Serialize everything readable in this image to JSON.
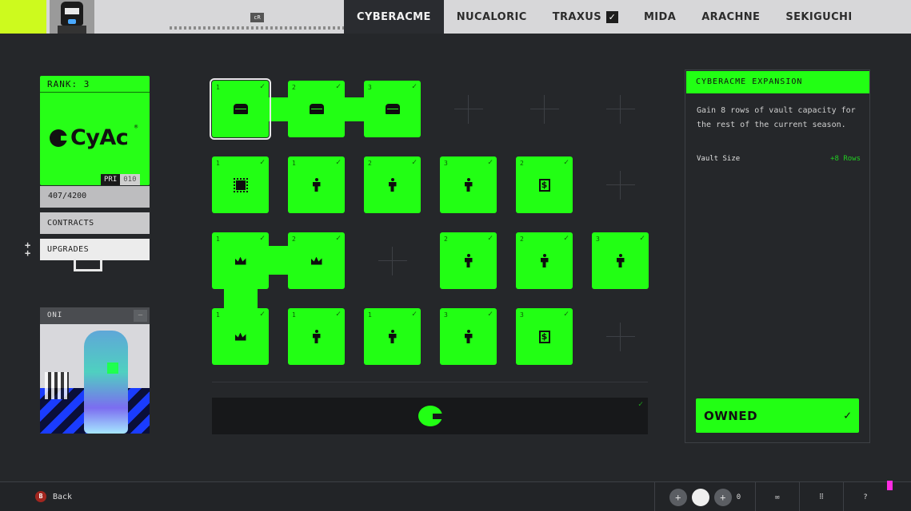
{
  "header": {
    "currency_badge": "cR",
    "tabs": [
      {
        "label": "CYBERACME",
        "active": true
      },
      {
        "label": "NUCALORIC"
      },
      {
        "label": "TRAXUS",
        "checked": true
      },
      {
        "label": "MIDA"
      },
      {
        "label": "ARACHNE"
      },
      {
        "label": "SEKIGUCHI"
      }
    ],
    "check_glyph": "✓"
  },
  "faction_card": {
    "rank_label": "RANK: 3",
    "logo_text": "CyAc",
    "registered_mark": "®",
    "pri_label": "PRI",
    "pri_value": "010",
    "progress": "407/4200"
  },
  "menu": {
    "contracts": "CONTRACTS",
    "upgrades": "UPGRADES"
  },
  "oni": {
    "label": "ONI",
    "minimize": "—"
  },
  "upgrade_grid": {
    "check_glyph": "✓",
    "cash_glyph": "$",
    "nodes": [
      {
        "level": "1",
        "icon": "vault-icon"
      },
      {
        "level": "2",
        "icon": "vault-icon"
      },
      {
        "level": "3",
        "icon": "vault-icon"
      },
      {
        "level": "1",
        "icon": "chip-icon"
      },
      {
        "level": "1",
        "icon": "person-icon"
      },
      {
        "level": "2",
        "icon": "person-icon"
      },
      {
        "level": "3",
        "icon": "person-icon"
      },
      {
        "level": "2",
        "icon": "cash-icon"
      },
      {
        "level": "1",
        "icon": "crown-icon"
      },
      {
        "level": "2",
        "icon": "crown-icon"
      },
      {
        "level": "2",
        "icon": "person-icon"
      },
      {
        "level": "2",
        "icon": "person-icon"
      },
      {
        "level": "3",
        "icon": "person-icon"
      },
      {
        "level": "1",
        "icon": "crown-icon"
      },
      {
        "level": "1",
        "icon": "person-icon"
      },
      {
        "level": "1",
        "icon": "person-icon"
      },
      {
        "level": "3",
        "icon": "person-icon"
      },
      {
        "level": "3",
        "icon": "cash-icon"
      }
    ]
  },
  "detail": {
    "title": "CYBERACME EXPANSION",
    "description": "Gain 8 rows of vault capacity for the rest of the current season.",
    "stat_label": "Vault Size",
    "stat_value": "+8 Rows",
    "button_label": "OWNED"
  },
  "footer": {
    "back_key": "B",
    "back_label": "Back",
    "plus_glyph": "+",
    "count": "0",
    "mail_glyph": "✉",
    "grid_glyph": "⠿",
    "help_glyph": "?"
  },
  "colors": {
    "accent": "#22ff14",
    "background": "#25272a",
    "topbar": "#d7d7d9",
    "notification": "#ff2be2"
  }
}
